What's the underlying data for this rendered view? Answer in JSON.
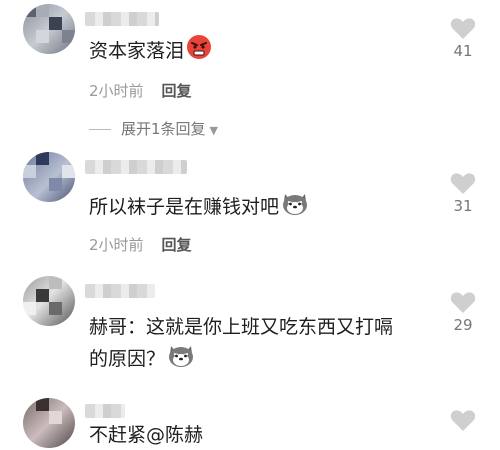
{
  "comments": [
    {
      "text": "资本家落泪",
      "emoji": "angry-face-icon",
      "time": "2小时前",
      "reply": "回复",
      "likes": "41",
      "expand": "展开1条回复"
    },
    {
      "text": "所以袜子是在赚钱对吧",
      "emoji": "husky-face-icon",
      "time": "2小时前",
      "reply": "回复",
      "likes": "31"
    },
    {
      "text_line1": "赫哥：这就是你上班又吃东西又打嗝",
      "text_line2": "的原因？",
      "emoji": "husky-face-icon",
      "likes": "29"
    },
    {
      "text": "不赶紧@陈赫"
    }
  ],
  "colors": {
    "meta": "#9a9a9a",
    "heart": "#cfcfcf"
  }
}
